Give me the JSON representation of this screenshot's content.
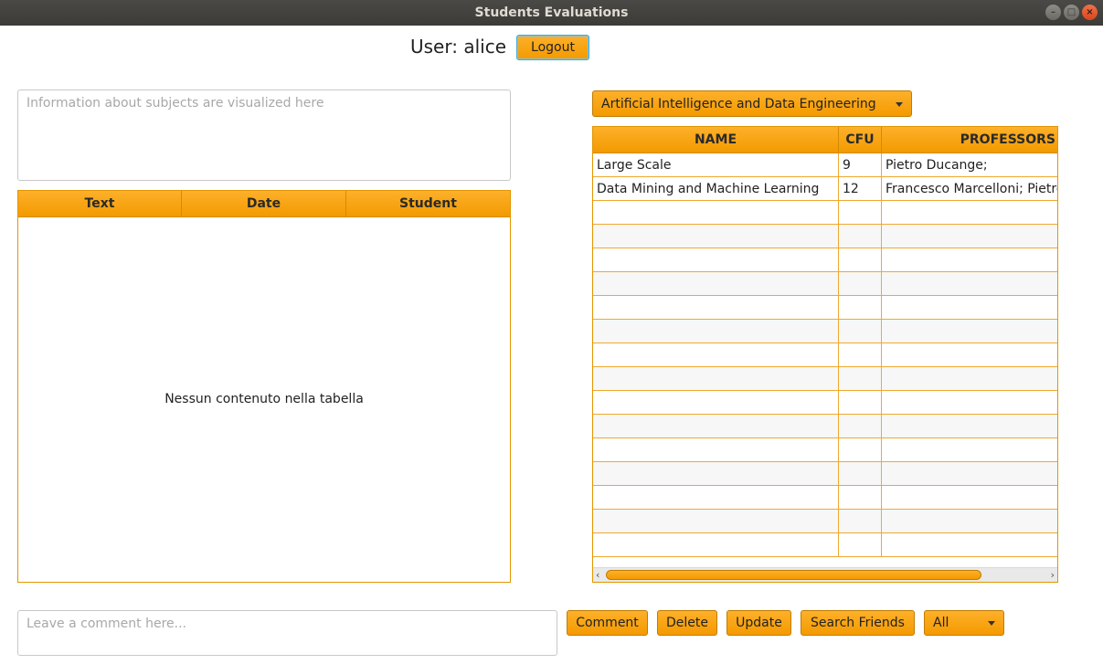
{
  "window": {
    "title": "Students Evaluations",
    "controls": {
      "minimize": "–",
      "maximize": "□",
      "close": "×"
    }
  },
  "header": {
    "user_label": "User: alice",
    "logout_label": "Logout"
  },
  "info": {
    "placeholder": "Information about subjects are visualized here"
  },
  "comments_table": {
    "columns": [
      "Text",
      "Date",
      "Student"
    ],
    "empty_message": "Nessun contenuto nella tabella"
  },
  "degree_select": {
    "selected": "Artificial Intelligence and Data Engineering"
  },
  "subjects_table": {
    "columns": [
      "NAME",
      "CFU",
      "PROFESSORS"
    ],
    "rows": [
      [
        "Large Scale",
        "9",
        "Pietro Ducange;"
      ],
      [
        "Data Mining and Machine Learning",
        "12",
        "Francesco Marcelloni; Pietro Ducange;"
      ]
    ]
  },
  "comment_bar": {
    "placeholder": "Leave a comment here...",
    "comment_label": "Comment",
    "delete_label": "Delete",
    "update_label": "Update",
    "search_friends_label": "Search Friends",
    "filter_selected": "All"
  },
  "colors": {
    "accent": "#f49a00",
    "accent_border": "#c27c00",
    "titlebar": "#3c3b37"
  }
}
